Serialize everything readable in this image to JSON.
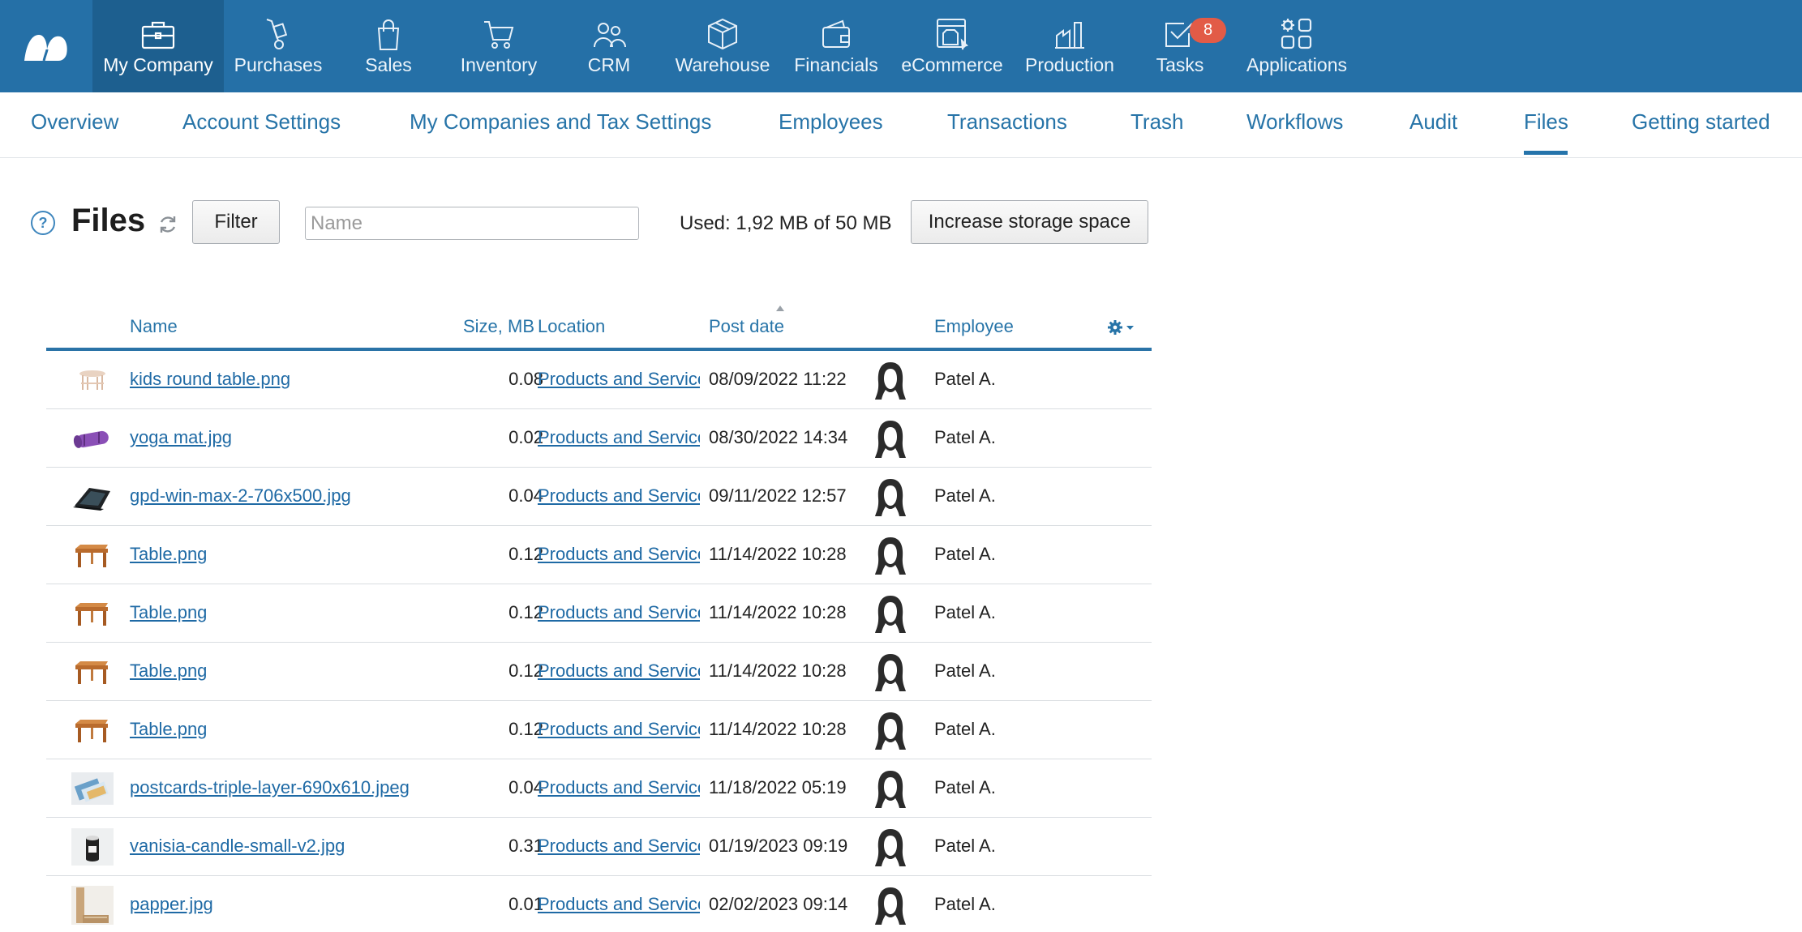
{
  "nav": {
    "items": [
      {
        "label": "My Company",
        "icon": "briefcase-icon",
        "active": true
      },
      {
        "label": "Purchases",
        "icon": "hand-truck-icon"
      },
      {
        "label": "Sales",
        "icon": "shopping-bag-icon"
      },
      {
        "label": "Inventory",
        "icon": "cart-icon"
      },
      {
        "label": "CRM",
        "icon": "people-icon"
      },
      {
        "label": "Warehouse",
        "icon": "box-icon"
      },
      {
        "label": "Financials",
        "icon": "wallet-icon"
      },
      {
        "label": "eCommerce",
        "icon": "storefront-icon"
      },
      {
        "label": "Production",
        "icon": "factory-icon"
      },
      {
        "label": "Tasks",
        "icon": "checkbox-icon"
      },
      {
        "label": "Applications",
        "icon": "apps-grid-icon"
      }
    ],
    "tasks_badge": "8",
    "brand_color": "#2570a7"
  },
  "subnav": {
    "tabs": [
      {
        "label": "Overview"
      },
      {
        "label": "Account Settings"
      },
      {
        "label": "My Companies and Tax Settings"
      },
      {
        "label": "Employees"
      },
      {
        "label": "Transactions"
      },
      {
        "label": "Trash"
      },
      {
        "label": "Workflows"
      },
      {
        "label": "Audit"
      },
      {
        "label": "Files",
        "active": true
      },
      {
        "label": "Getting started"
      }
    ]
  },
  "toolbar": {
    "title": "Files",
    "filter_label": "Filter",
    "search_placeholder": "Name",
    "used_text": "Used: 1,92 MB of 50 MB",
    "increase_label": "Increase storage space"
  },
  "table": {
    "headers": {
      "name": "Name",
      "size": "Size, MB",
      "location": "Location",
      "post_date": "Post date",
      "employee": "Employee"
    },
    "rows": [
      {
        "name": "kids round table.png",
        "size": "0.08",
        "location": "Products and Services",
        "date": "08/09/2022 11:22",
        "employee": "Patel A.",
        "thumb": "kids-table"
      },
      {
        "name": "yoga mat.jpg",
        "size": "0.02",
        "location": "Products and Services",
        "date": "08/30/2022 14:34",
        "employee": "Patel A.",
        "thumb": "yoga-mat"
      },
      {
        "name": "gpd-win-max-2-706x500.jpg",
        "size": "0.04",
        "location": "Products and Services",
        "date": "09/11/2022 12:57",
        "employee": "Patel A.",
        "thumb": "laptop"
      },
      {
        "name": "Table.png",
        "size": "0.12",
        "location": "Products and Services",
        "date": "11/14/2022 10:28",
        "employee": "Patel A.",
        "thumb": "table"
      },
      {
        "name": "Table.png",
        "size": "0.12",
        "location": "Products and Services",
        "date": "11/14/2022 10:28",
        "employee": "Patel A.",
        "thumb": "table"
      },
      {
        "name": "Table.png",
        "size": "0.12",
        "location": "Products and Services",
        "date": "11/14/2022 10:28",
        "employee": "Patel A.",
        "thumb": "table"
      },
      {
        "name": "Table.png",
        "size": "0.12",
        "location": "Products and Services",
        "date": "11/14/2022 10:28",
        "employee": "Patel A.",
        "thumb": "table"
      },
      {
        "name": "postcards-triple-layer-690x610.jpeg",
        "size": "0.04",
        "location": "Products and Services",
        "date": "11/18/2022 05:19",
        "employee": "Patel A.",
        "thumb": "postcards"
      },
      {
        "name": "vanisia-candle-small-v2.jpg",
        "size": "0.31",
        "location": "Products and Services",
        "date": "01/19/2023 09:19",
        "employee": "Patel A.",
        "thumb": "candle"
      },
      {
        "name": "papper.jpg",
        "size": "0.01",
        "location": "Products and Services",
        "date": "02/02/2023 09:14",
        "employee": "Patel A.",
        "thumb": "paper"
      }
    ]
  }
}
